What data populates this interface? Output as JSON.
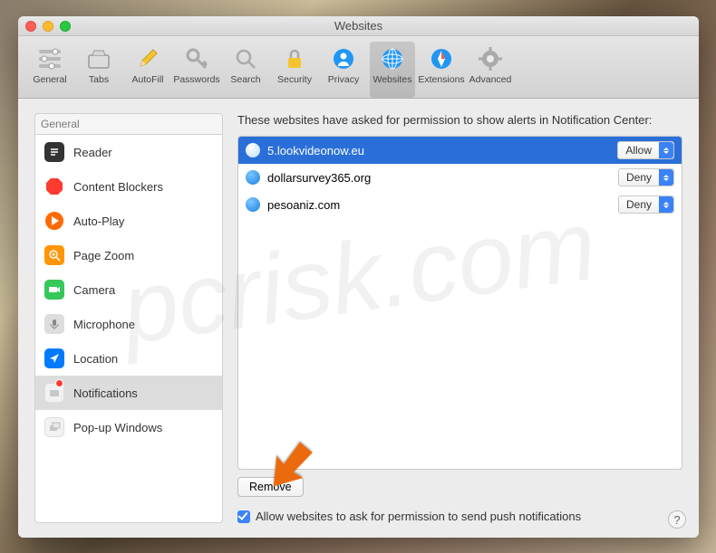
{
  "window": {
    "title": "Websites"
  },
  "toolbar": {
    "items": [
      {
        "label": "General"
      },
      {
        "label": "Tabs"
      },
      {
        "label": "AutoFill"
      },
      {
        "label": "Passwords"
      },
      {
        "label": "Search"
      },
      {
        "label": "Security"
      },
      {
        "label": "Privacy"
      },
      {
        "label": "Websites"
      },
      {
        "label": "Extensions"
      },
      {
        "label": "Advanced"
      }
    ]
  },
  "sidebar": {
    "header": "General",
    "items": [
      {
        "label": "Reader"
      },
      {
        "label": "Content Blockers"
      },
      {
        "label": "Auto-Play"
      },
      {
        "label": "Page Zoom"
      },
      {
        "label": "Camera"
      },
      {
        "label": "Microphone"
      },
      {
        "label": "Location"
      },
      {
        "label": "Notifications"
      },
      {
        "label": "Pop-up Windows"
      }
    ]
  },
  "main": {
    "description": "These websites have asked for permission to show alerts in Notification Center:",
    "sites": [
      {
        "domain": "5.lookvideonow.eu",
        "permission": "Allow"
      },
      {
        "domain": "dollarsurvey365.org",
        "permission": "Deny"
      },
      {
        "domain": "pesoaniz.com",
        "permission": "Deny"
      }
    ],
    "remove_label": "Remove",
    "checkbox_label": "Allow websites to ask for permission to send push notifications"
  },
  "watermark": "pcrisk.com",
  "colors": {
    "accent": "#3b82f6",
    "selection": "#2a6fd8",
    "arrow": "#eb6b0f"
  }
}
